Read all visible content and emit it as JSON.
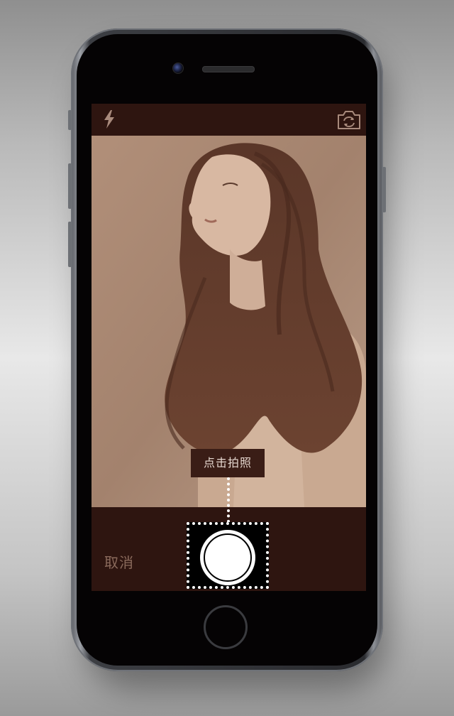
{
  "screen": {
    "tooltip_text": "点击拍照",
    "cancel_label": "取消"
  },
  "icons": {
    "flash": "flash-icon",
    "switch_camera": "switch-camera-icon",
    "shutter": "shutter-button-icon"
  },
  "colors": {
    "bar_background": "#2e1510",
    "photo_tint": "#a98672",
    "tooltip_background": "#3a1d16",
    "shutter": "#ffffff"
  }
}
